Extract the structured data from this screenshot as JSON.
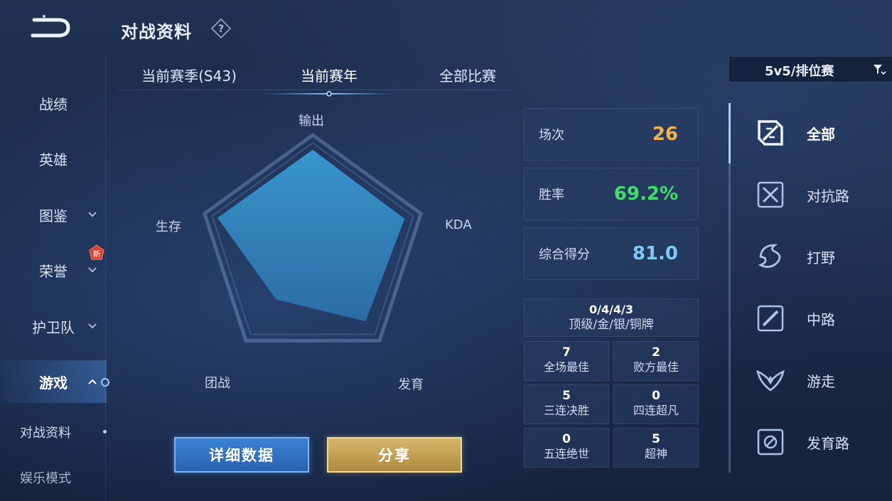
{
  "header": {
    "title": "对战资料"
  },
  "left_nav": {
    "items": [
      {
        "label": "战绩"
      },
      {
        "label": "英雄"
      },
      {
        "label": "图鉴"
      },
      {
        "label": "荣誉",
        "badge": "新"
      },
      {
        "label": "护卫队"
      },
      {
        "label": "游戏"
      }
    ],
    "sub_items": [
      {
        "label": "对战资料"
      },
      {
        "label": "娱乐模式"
      }
    ]
  },
  "tabs": [
    {
      "label": "当前赛季(S43)"
    },
    {
      "label": "当前赛年"
    },
    {
      "label": "全部比赛"
    }
  ],
  "active_tab": "当前赛年",
  "radar": {
    "labels": {
      "output": "输出",
      "kda": "KDA",
      "develop": "发育",
      "teamfight": "团战",
      "survive": "生存"
    },
    "values": {
      "output": 0.87,
      "kda": 0.85,
      "develop": 0.79,
      "teamfight": 0.55,
      "survive": 0.88
    }
  },
  "stats": {
    "matches": {
      "label": "场次",
      "value": "26",
      "color": "#f1b24a"
    },
    "winrate": {
      "label": "胜率",
      "value": "69.2%",
      "color": "#3fe06a"
    },
    "score": {
      "label": "综合得分",
      "value": "81.0",
      "color": "#7fcaf5"
    }
  },
  "medals": {
    "value": "0/4/4/3",
    "label": "顶级/金/银/铜牌"
  },
  "grid": [
    {
      "num": "7",
      "label": "全场最佳"
    },
    {
      "num": "2",
      "label": "败方最佳"
    },
    {
      "num": "5",
      "label": "三连决胜"
    },
    {
      "num": "0",
      "label": "四连超凡"
    },
    {
      "num": "0",
      "label": "五连绝世"
    },
    {
      "num": "5",
      "label": "超神"
    }
  ],
  "buttons": {
    "detail": "详细数据",
    "share": "分享"
  },
  "filter": {
    "label": "5v5/排位赛"
  },
  "positions": [
    {
      "label": "全部",
      "icon": "all-position-icon"
    },
    {
      "label": "对抗路",
      "icon": "clash-lane-icon"
    },
    {
      "label": "打野",
      "icon": "jungle-icon"
    },
    {
      "label": "中路",
      "icon": "mid-lane-icon"
    },
    {
      "label": "游走",
      "icon": "roam-icon"
    },
    {
      "label": "发育路",
      "icon": "farm-lane-icon"
    }
  ]
}
